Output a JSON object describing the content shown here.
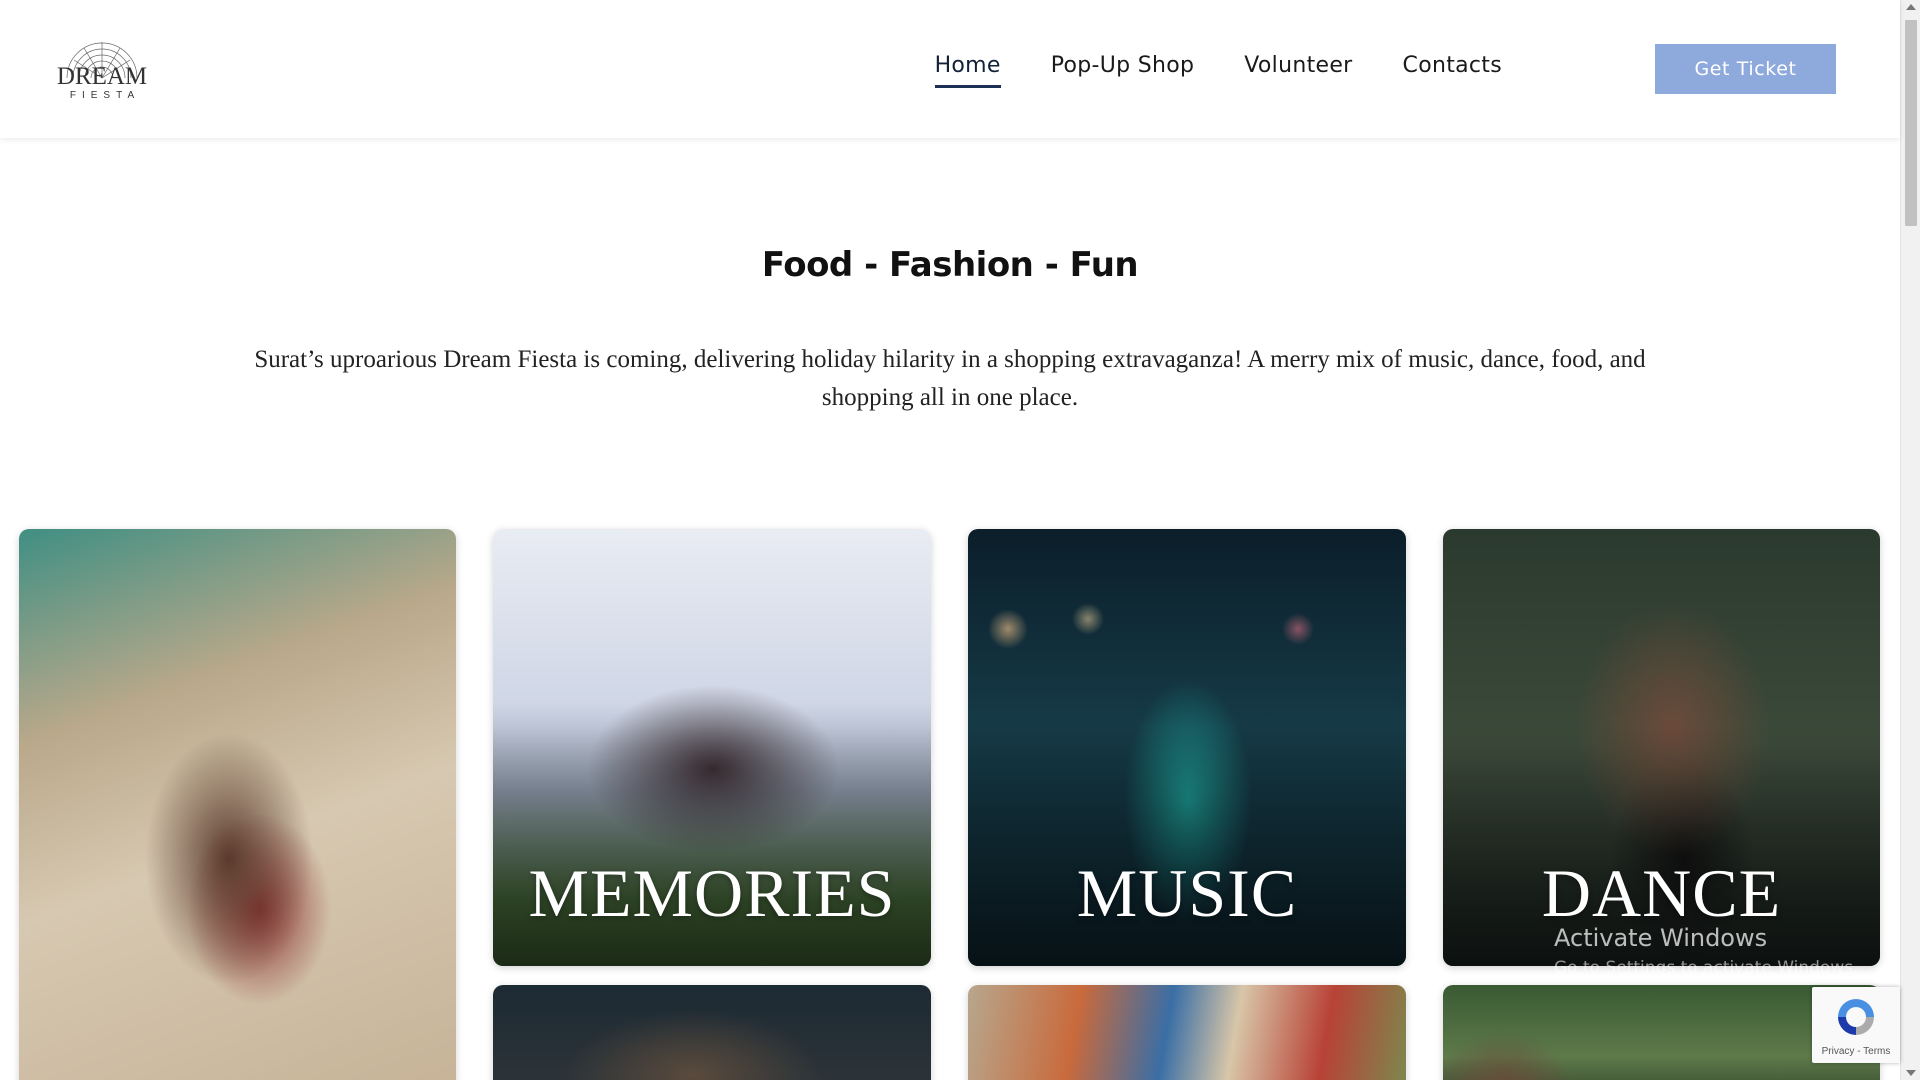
{
  "brand": {
    "name": "DREAM",
    "sub": "FIESTA"
  },
  "nav": {
    "items": [
      {
        "label": "Home",
        "active": true
      },
      {
        "label": "Pop-Up Shop",
        "active": false
      },
      {
        "label": "Volunteer",
        "active": false
      },
      {
        "label": "Contacts",
        "active": false
      }
    ],
    "cta_label": "Get Ticket"
  },
  "hero": {
    "headline": "Food - Fashion - Fun",
    "description": "Surat’s uproarious Dream Fiesta is coming, delivering holiday hilarity in a shopping extravaganza! A merry mix of music, dance, food, and shopping all in one place."
  },
  "gallery": {
    "cards": [
      {
        "label": ""
      },
      {
        "label": "MEMORIES"
      },
      {
        "label": "MUSIC"
      },
      {
        "label": "DANCE"
      }
    ]
  },
  "system": {
    "activate_title": "Activate Windows",
    "activate_sub": "Go to Settings to activate Windows.",
    "recaptcha_links": "Privacy - Terms"
  },
  "colors": {
    "cta_bg": "#8ea9dc",
    "nav_active_underline": "#1c2f55"
  }
}
